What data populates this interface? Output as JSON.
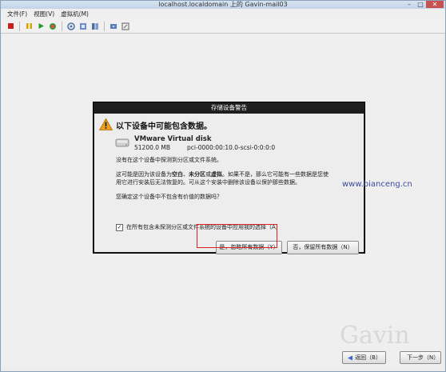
{
  "window": {
    "title": "localhost.localdomain 上的 Gavin-mail03",
    "controls": [
      "–",
      "□",
      "✕"
    ]
  },
  "menu": [
    {
      "label": "文件(F)"
    },
    {
      "label": "视图(V)"
    },
    {
      "label": "虚拟机(M)"
    }
  ],
  "toolbar_icons": [
    "stop-icon",
    "pause-icon",
    "play-icon",
    "reset-icon",
    "snapshot-icon",
    "revert-snapshot-icon",
    "manage-snapshots-icon",
    "send-keys-icon",
    "fullscreen-icon"
  ],
  "dialog": {
    "title": "存储设备警告",
    "heading": "以下设备中可能包含数据。",
    "disk_name": "VMware Virtual disk",
    "disk_size": "51200.0 MB",
    "disk_path": "pci-0000:00:10.0-scsi-0:0:0:0",
    "para1": "没有在这个设备中探测到分区或文件系统。",
    "para2_a": "这可能是因为该设备为",
    "para2_b1": "空白",
    "para2_c": "、",
    "para2_b2": "未分区",
    "para2_d": "或",
    "para2_b3": "虚拟",
    "para2_e": "。如果不是，那么它可能有一些数据是您使",
    "para2_line2": "用它进行安装后无法恢复的。可从这个安装中删除该设备以保护那些数据。",
    "para3": "您确定这个设备中不包含有价值的数据吗？",
    "checkbox_checked": true,
    "checkbox_label": "在所有包含未探测分区或文件系统的设备中应用我的选择（A）",
    "yes_button": "是，忽略所有数据（Y）",
    "no_button": "否，保留所有数据（N）"
  },
  "watermark": "www.bianceng.cn",
  "brand": "Gavin",
  "nav": {
    "back": "返回（B）",
    "next": "下一步（N）"
  },
  "colors": {
    "highlight": "#dd2222",
    "dialog_titlebar": "#1e1e1e",
    "warning": "#f0a020"
  }
}
